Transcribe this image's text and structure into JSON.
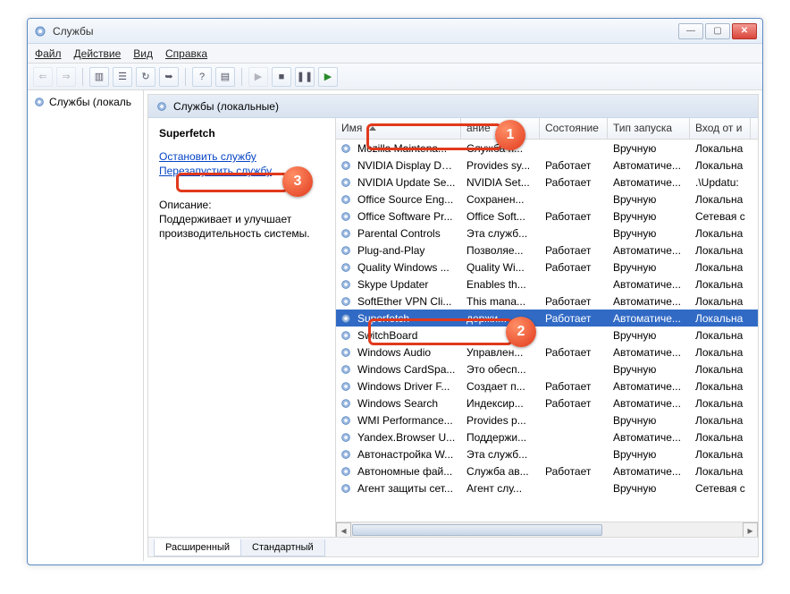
{
  "window": {
    "title": "Службы"
  },
  "menu": {
    "file": "Файл",
    "action": "Действие",
    "view": "Вид",
    "help": "Справка"
  },
  "leftTree": {
    "item": "Службы (локаль"
  },
  "mainHeader": "Службы (локальные)",
  "selectedService": {
    "name": "Superfetch",
    "stopLink": "Остановить службу",
    "restartLink": "Перезапустить службу",
    "descLabel": "Описание:",
    "desc": "Поддерживает и улучшает производительность системы."
  },
  "columns": [
    "Имя",
    "ание",
    "Состояние",
    "Тип запуска",
    "Вход от и"
  ],
  "rows": [
    {
      "n": "Mozilla Maintena...",
      "d": "Служба п...",
      "s": "",
      "t": "Вручную",
      "l": "Локальна"
    },
    {
      "n": "NVIDIA Display Dri...",
      "d": "Provides sy...",
      "s": "Работает",
      "t": "Автоматиче...",
      "l": "Локальна"
    },
    {
      "n": "NVIDIA Update Se...",
      "d": "NVIDIA Set...",
      "s": "Работает",
      "t": "Автоматиче...",
      "l": ".\\Updatu:"
    },
    {
      "n": "Office  Source Eng...",
      "d": "Сохранен...",
      "s": "",
      "t": "Вручную",
      "l": "Локальна"
    },
    {
      "n": "Office Software Pr...",
      "d": "Office Soft...",
      "s": "Работает",
      "t": "Вручную",
      "l": "Сетевая с"
    },
    {
      "n": "Parental Controls",
      "d": "Эта служб...",
      "s": "",
      "t": "Вручную",
      "l": "Локальна"
    },
    {
      "n": "Plug-and-Play",
      "d": "Позволяе...",
      "s": "Работает",
      "t": "Автоматиче...",
      "l": "Локальна"
    },
    {
      "n": "Quality Windows ...",
      "d": "Quality Wi...",
      "s": "Работает",
      "t": "Вручную",
      "l": "Локальна"
    },
    {
      "n": "Skype Updater",
      "d": "Enables th...",
      "s": "",
      "t": "Автоматиче...",
      "l": "Локальна"
    },
    {
      "n": "SoftEther VPN Cli...",
      "d": "This mana...",
      "s": "Работает",
      "t": "Автоматиче...",
      "l": "Локальна"
    },
    {
      "n": "Superfetch",
      "d": "держи...",
      "s": "Работает",
      "t": "Автоматиче...",
      "l": "Локальна",
      "sel": true
    },
    {
      "n": "SwitchBoard",
      "d": "",
      "s": "",
      "t": "Вручную",
      "l": "Локальна"
    },
    {
      "n": "Windows Audio",
      "d": "Управлен...",
      "s": "Работает",
      "t": "Автоматиче...",
      "l": "Локальна"
    },
    {
      "n": "Windows CardSpa...",
      "d": "Это обесп...",
      "s": "",
      "t": "Вручную",
      "l": "Локальна"
    },
    {
      "n": "Windows Driver F...",
      "d": "Создает п...",
      "s": "Работает",
      "t": "Автоматиче...",
      "l": "Локальна"
    },
    {
      "n": "Windows Search",
      "d": "Индексир...",
      "s": "Работает",
      "t": "Автоматиче...",
      "l": "Локальна"
    },
    {
      "n": "WMI Performance...",
      "d": "Provides p...",
      "s": "",
      "t": "Вручную",
      "l": "Локальна"
    },
    {
      "n": "Yandex.Browser U...",
      "d": "Поддержи...",
      "s": "",
      "t": "Автоматиче...",
      "l": "Локальна"
    },
    {
      "n": "Автонастройка W...",
      "d": "Эта служб...",
      "s": "",
      "t": "Вручную",
      "l": "Локальна"
    },
    {
      "n": "Автономные фай...",
      "d": "Служба ав...",
      "s": "Работает",
      "t": "Автоматиче...",
      "l": "Локальна"
    },
    {
      "n": "Агент защиты сет...",
      "d": "Агент слу...",
      "s": "",
      "t": "Вручную",
      "l": "Сетевая с"
    }
  ],
  "tabs": {
    "extended": "Расширенный",
    "standard": "Стандартный"
  },
  "badges": {
    "b1": "1",
    "b2": "2",
    "b3": "3"
  }
}
